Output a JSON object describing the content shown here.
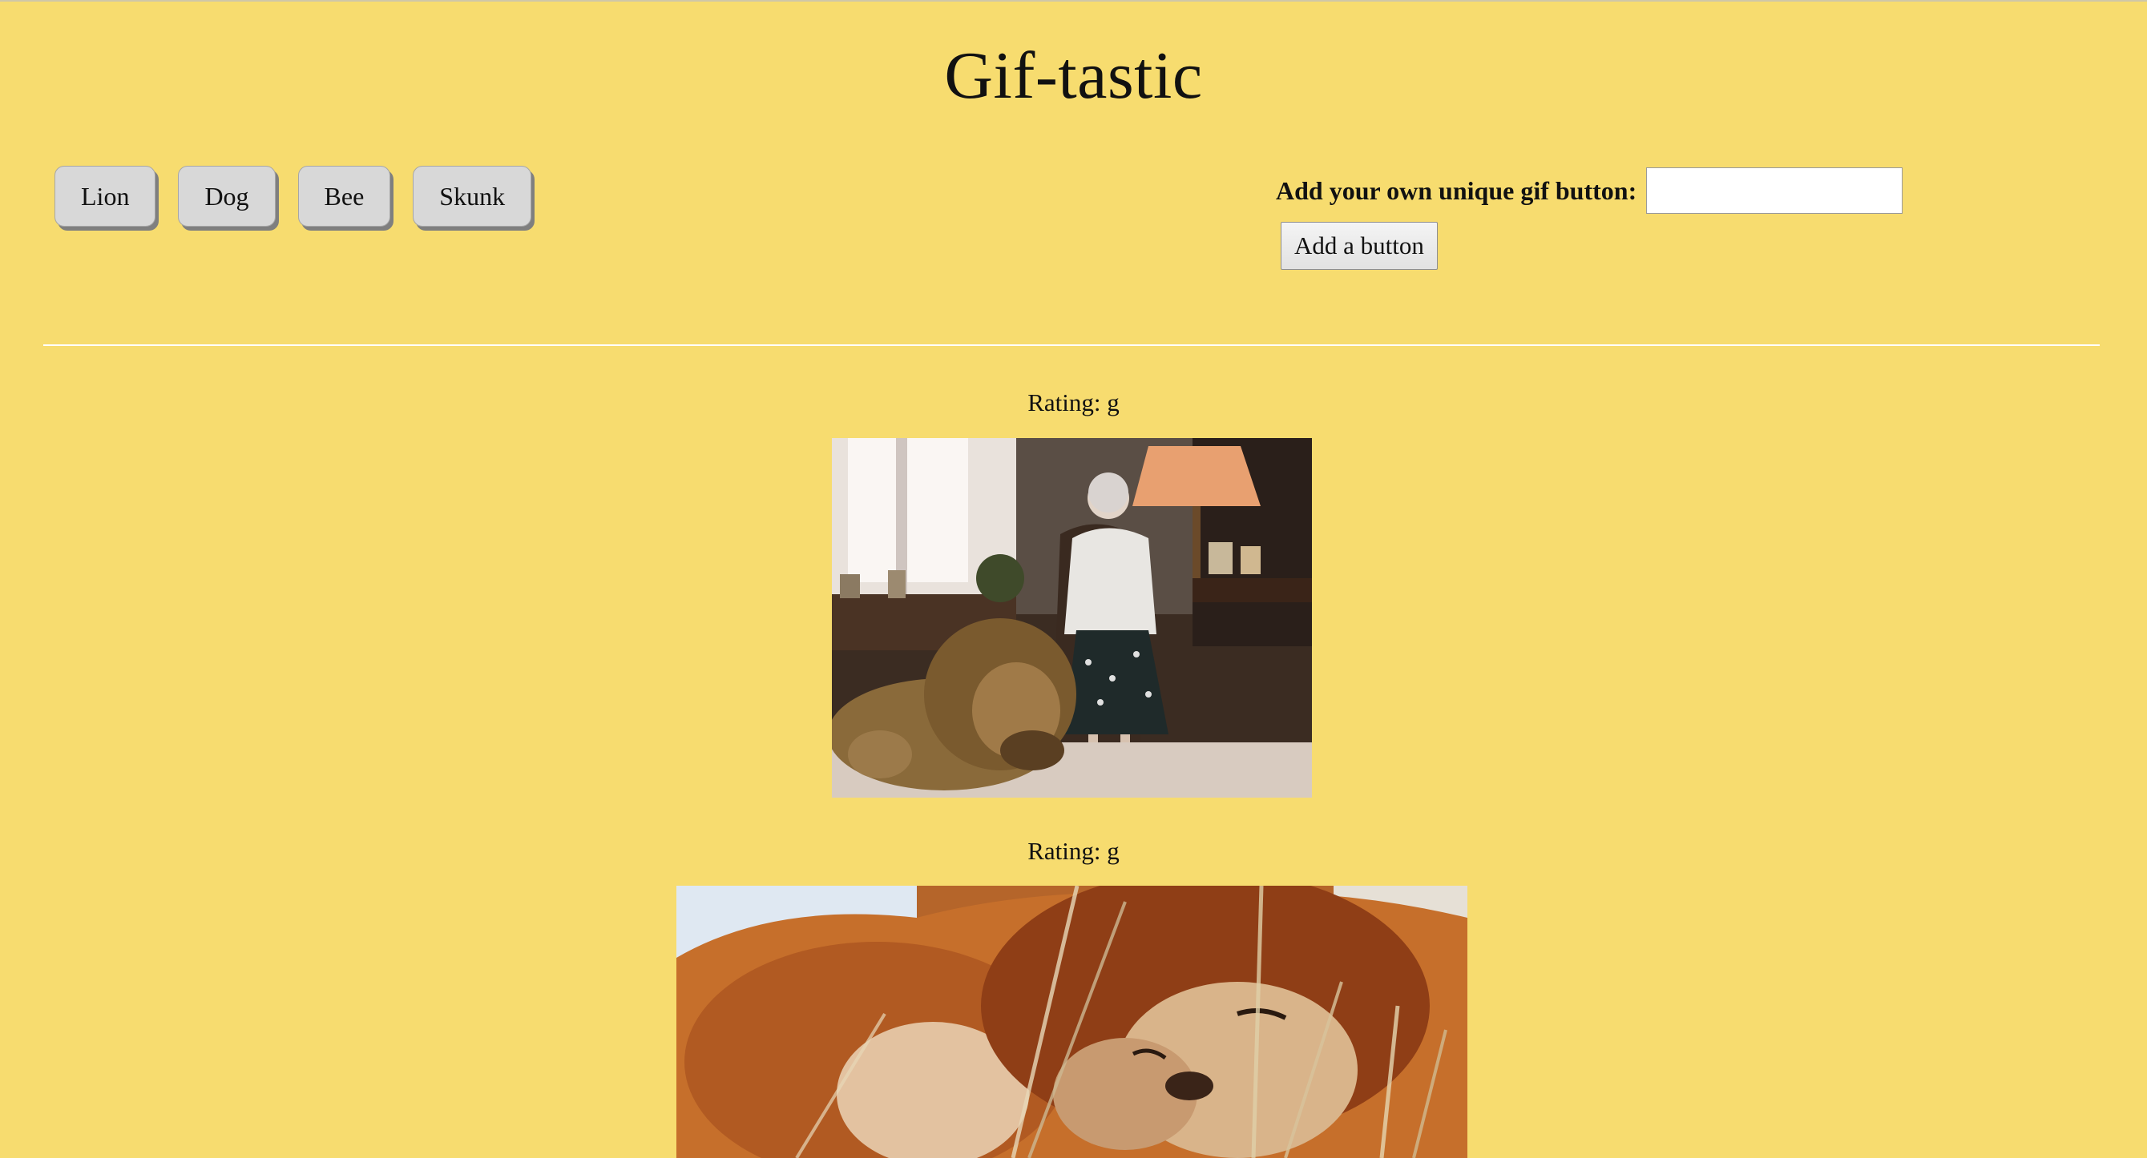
{
  "page": {
    "title": "Gif-tastic"
  },
  "topic_buttons": [
    {
      "label": "Lion"
    },
    {
      "label": "Dog"
    },
    {
      "label": "Bee"
    },
    {
      "label": "Skunk"
    }
  ],
  "add_form": {
    "label": "Add your own unique gif button:",
    "input_value": "",
    "submit_label": "Add a button"
  },
  "gifs": [
    {
      "rating": "Rating: g",
      "subject": "elderly woman seated in a living room with a lion lying on the rug"
    },
    {
      "rating": "Rating: g",
      "subject": "two lions nuzzling in tall grass"
    }
  ],
  "colors": {
    "background": "#f7dc6f",
    "button_bg": "#d8d8d8",
    "divider": "#ffffff"
  }
}
